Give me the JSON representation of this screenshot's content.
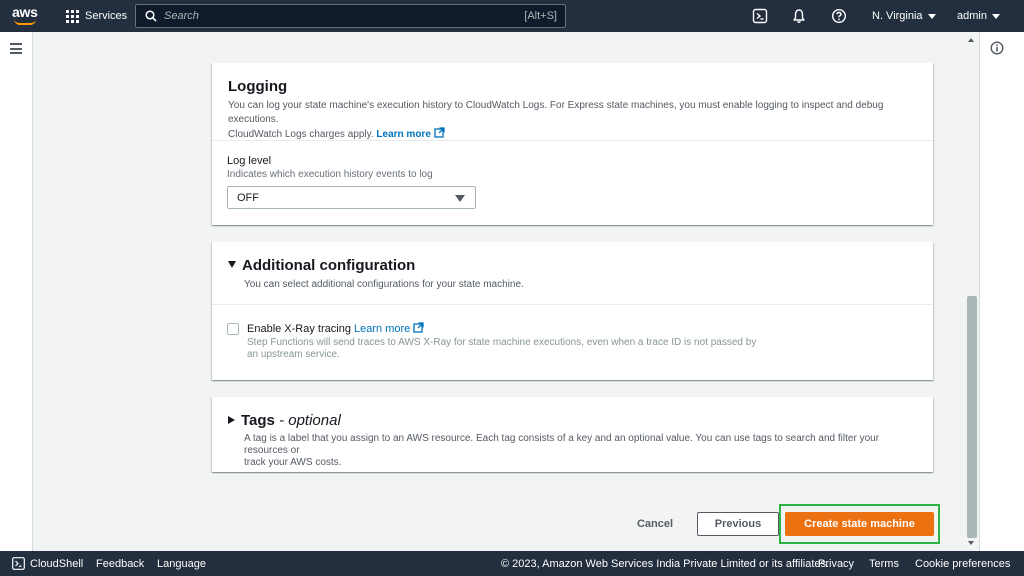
{
  "topnav": {
    "logo_text": "aws",
    "services_label": "Services",
    "search_placeholder": "Search",
    "search_shortcut": "[Alt+S]",
    "region": "N. Virginia",
    "account": "admin"
  },
  "logging": {
    "title": "Logging",
    "description": "You can log your state machine's execution history to CloudWatch Logs. For Express state machines, you must enable logging to inspect and debug executions.",
    "description_line2": "CloudWatch Logs charges apply.",
    "learn_more": "Learn more",
    "log_level_label": "Log level",
    "log_level_desc": "Indicates which execution history events to log",
    "log_level_value": "OFF"
  },
  "additional": {
    "title": "Additional configuration",
    "description": "You can select additional configurations for your state machine.",
    "xray_label": "Enable X-Ray tracing",
    "xray_learn_more": "Learn more",
    "xray_desc_line1": "Step Functions will send traces to AWS X-Ray for state machine executions, even when a trace ID is not passed by",
    "xray_desc_line2": "an upstream service.",
    "xray_checked": false
  },
  "tags": {
    "title": "Tags",
    "title_suffix": "- optional",
    "description_line1": "A tag is a label that you assign to an AWS resource. Each tag consists of a key and an optional value. You can use tags to search and filter your resources or",
    "description_line2": "track your AWS costs."
  },
  "actions": {
    "cancel": "Cancel",
    "previous": "Previous",
    "create": "Create state machine"
  },
  "footer": {
    "cloudshell": "CloudShell",
    "feedback": "Feedback",
    "language": "Language",
    "copyright": "© 2023, Amazon Web Services India Private Limited or its affiliates.",
    "privacy": "Privacy",
    "terms": "Terms",
    "cookies": "Cookie preferences"
  },
  "colors": {
    "nav_bg": "#232f3e",
    "primary": "#ec7211",
    "link": "#0073bb",
    "highlight": "#2fb344"
  }
}
